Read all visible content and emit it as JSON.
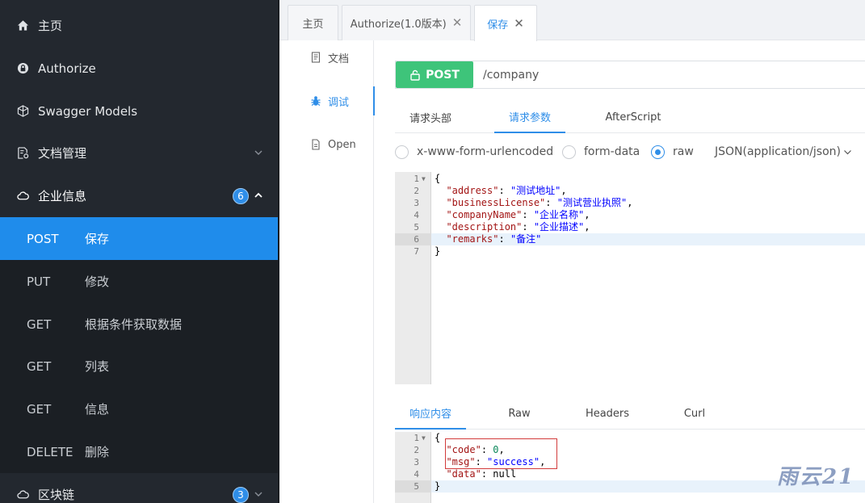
{
  "sidebar": {
    "items": [
      {
        "label": "主页",
        "icon": "home-icon"
      },
      {
        "label": "Authorize",
        "icon": "lock-icon"
      },
      {
        "label": "Swagger Models",
        "icon": "cube-icon"
      },
      {
        "label": "文档管理",
        "icon": "document-settings-icon"
      },
      {
        "label": "企业信息",
        "icon": "cloud-icon",
        "badge": "6",
        "expanded": true
      },
      {
        "label": "区块链",
        "icon": "cloud-icon",
        "badge": "3"
      }
    ],
    "submenu": [
      {
        "method": "POST",
        "label": "保存",
        "active": true
      },
      {
        "method": "PUT",
        "label": "修改"
      },
      {
        "method": "GET",
        "label": "根据条件获取数据"
      },
      {
        "method": "GET",
        "label": "列表"
      },
      {
        "method": "GET",
        "label": "信息"
      },
      {
        "method": "DELETE",
        "label": "删除"
      }
    ]
  },
  "tabs": [
    {
      "label": "主页",
      "closable": false
    },
    {
      "label": "Authorize(1.0版本)",
      "closable": true
    },
    {
      "label": "保存",
      "closable": true,
      "active": true
    }
  ],
  "vtabs": [
    {
      "label": "文档",
      "icon": "document-icon"
    },
    {
      "label": "调试",
      "icon": "bug-icon",
      "active": true
    },
    {
      "label": "Open",
      "icon": "file-icon"
    }
  ],
  "request": {
    "method": "POST",
    "url": "/company",
    "tabs": [
      "请求头部",
      "请求参数",
      "AfterScript"
    ],
    "active_tab": "请求参数",
    "content_types": [
      "x-www-form-urlencoded",
      "form-data",
      "raw"
    ],
    "selected_content_type": "raw",
    "raw_type": "JSON(application/json)",
    "body_lines": [
      {
        "n": "1",
        "text": "{"
      },
      {
        "n": "2",
        "key": "\"address\"",
        "val": "\"测试地址\"",
        "tail": ","
      },
      {
        "n": "3",
        "key": "\"businessLicense\"",
        "val": "\"测试营业执照\"",
        "tail": ","
      },
      {
        "n": "4",
        "key": "\"companyName\"",
        "val": "\"企业名称\"",
        "tail": ","
      },
      {
        "n": "5",
        "key": "\"description\"",
        "val": "\"企业描述\"",
        "tail": ","
      },
      {
        "n": "6",
        "key": "\"remarks\"",
        "val": "\"备注\"",
        "tail": ""
      },
      {
        "n": "7",
        "text": "}"
      }
    ]
  },
  "response": {
    "tabs": [
      "响应内容",
      "Raw",
      "Headers",
      "Curl"
    ],
    "active_tab": "响应内容",
    "lines": [
      {
        "n": "1",
        "text": "{"
      },
      {
        "n": "2",
        "key": "\"code\"",
        "num": "0",
        "tail": ","
      },
      {
        "n": "3",
        "key": "\"msg\"",
        "val": "\"success\"",
        "tail": ","
      },
      {
        "n": "4",
        "key": "\"data\"",
        "plain": "null",
        "tail": ""
      },
      {
        "n": "5",
        "text": "}"
      }
    ]
  },
  "watermark": "雨云21",
  "colors": {
    "accent": "#2f8ee8",
    "post": "#3ec47a",
    "sidebar": "#23282f"
  }
}
